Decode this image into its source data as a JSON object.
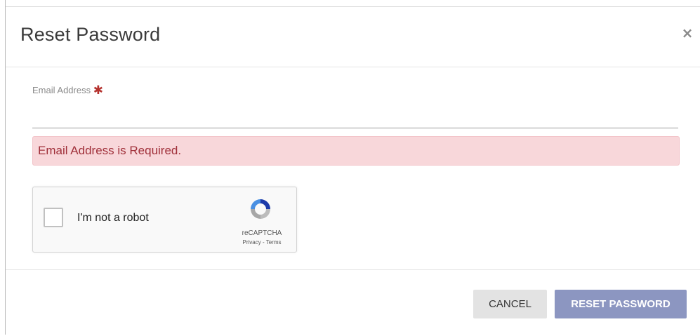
{
  "modal": {
    "title": "Reset Password",
    "close_symbol": "×"
  },
  "form": {
    "email": {
      "label": "Email Address",
      "required_marker": "✱",
      "value": "",
      "placeholder": ""
    },
    "error_message": "Email Address is Required."
  },
  "recaptcha": {
    "label": "I'm not a robot",
    "brand": "reCAPTCHA",
    "privacy_link": "Privacy",
    "separator": " - ",
    "terms_link": "Terms",
    "checked": false
  },
  "footer": {
    "cancel_label": "CANCEL",
    "reset_label": "RESET PASSWORD"
  },
  "colors": {
    "error_background": "#f8d7da",
    "error_text": "#a0303a",
    "required_star": "#b5322e",
    "primary_button": "#8c96c1",
    "secondary_button": "#e3e3e3"
  },
  "icons": {
    "close": "close-icon",
    "recaptcha": "recaptcha-logo-icon"
  }
}
